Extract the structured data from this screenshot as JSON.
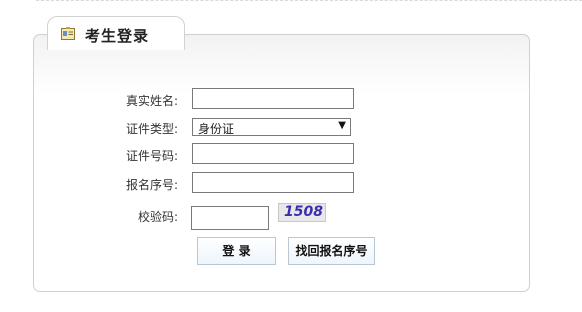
{
  "header": {
    "title": "考生登录",
    "icon": "id-card-icon"
  },
  "form": {
    "real_name": {
      "label": "真实姓名:",
      "value": ""
    },
    "id_type": {
      "label": "证件类型:",
      "selected": "身份证"
    },
    "id_number": {
      "label": "证件号码:",
      "value": ""
    },
    "reg_number": {
      "label": "报名序号:",
      "value": ""
    },
    "captcha": {
      "label": "校验码:",
      "value": "",
      "image_text": "1508"
    }
  },
  "buttons": {
    "login": "登 录",
    "recover": "找回报名序号"
  }
}
